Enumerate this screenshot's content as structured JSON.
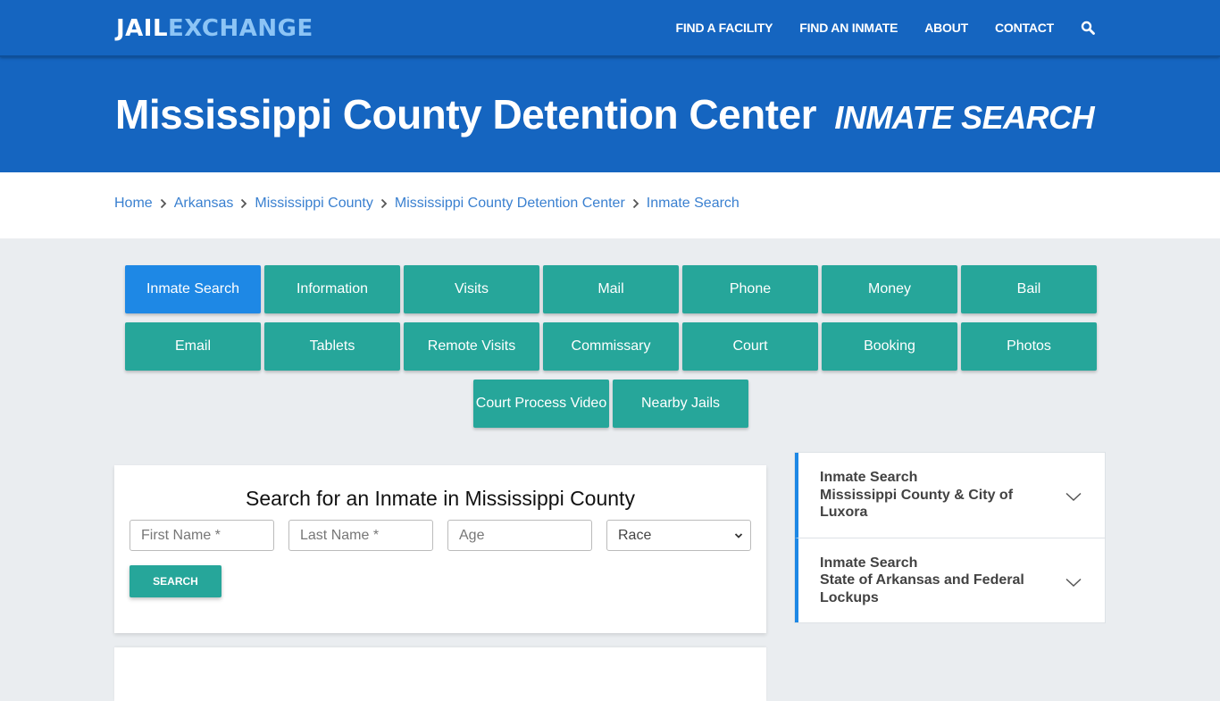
{
  "brand": {
    "part1": "JAIL",
    "part2": "EXCHANGE"
  },
  "nav": {
    "items": [
      "FIND A FACILITY",
      "FIND AN INMATE",
      "ABOUT",
      "CONTACT"
    ],
    "search_icon": "search-icon"
  },
  "hero": {
    "title": "Mississippi County Detention Center",
    "subtitle": "INMATE SEARCH"
  },
  "breadcrumb": [
    "Home",
    "Arkansas",
    "Mississippi County",
    "Mississippi County Detention Center",
    "Inmate Search"
  ],
  "tabs": {
    "row1": [
      "Inmate Search",
      "Information",
      "Visits",
      "Mail",
      "Phone",
      "Money",
      "Bail"
    ],
    "row2": [
      "Email",
      "Tablets",
      "Remote Visits",
      "Commissary",
      "Court",
      "Booking",
      "Photos"
    ],
    "row3": [
      "Court Process Video",
      "Nearby Jails"
    ],
    "active": "Inmate Search"
  },
  "search": {
    "heading": "Search for an Inmate in Mississippi County",
    "first_name_placeholder": "First Name *",
    "last_name_placeholder": "Last Name *",
    "age_placeholder": "Age",
    "race_selected": "Race",
    "button": "SEARCH"
  },
  "sidebar": [
    {
      "line1": "Inmate Search",
      "line2": "Mississippi County & City of Luxora"
    },
    {
      "line1": "Inmate Search",
      "line2": "State of Arkansas and Federal Lockups"
    }
  ],
  "colors": {
    "primary": "#1565c0",
    "teal": "#26a69a",
    "active": "#1e88e5",
    "link": "#3a80d0"
  }
}
